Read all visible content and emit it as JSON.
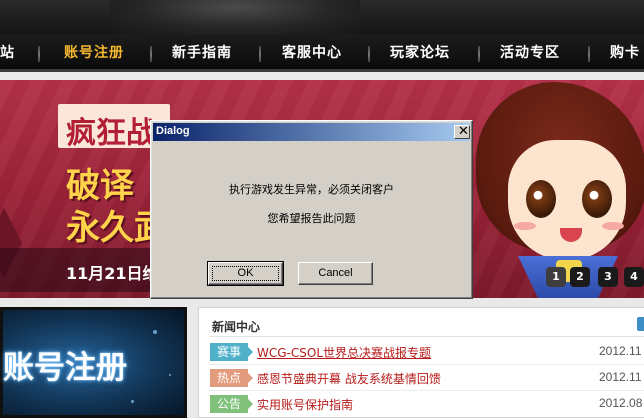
{
  "nav": {
    "items": [
      {
        "label": "站"
      },
      {
        "label": "账号注册"
      },
      {
        "label": "新手指南"
      },
      {
        "label": "客服中心"
      },
      {
        "label": "玩家论坛"
      },
      {
        "label": "活动专区"
      },
      {
        "label": "购卡"
      }
    ],
    "active_color": "#f5b830"
  },
  "banner": {
    "title_partial": "疯狂战",
    "headline_line1": "破译",
    "headline_line2": "永久武",
    "date_text": "11月21日维",
    "pager": [
      "1",
      "2",
      "3",
      "4"
    ]
  },
  "promo": {
    "label": "账号注册"
  },
  "news": {
    "title": "新闻中心",
    "rows": [
      {
        "tag": "赛事",
        "tag_color": "#4fb1c9",
        "text": "WCG-CSOL世界总决赛战报专题",
        "date": "2012.11"
      },
      {
        "tag": "热点",
        "tag_color": "#e39b7e",
        "text": "感恩节盛典开幕 战友系统基情回馈",
        "date": "2012.11"
      },
      {
        "tag": "公告",
        "tag_color": "#7fc07a",
        "text": "实用账号保护指南",
        "date": "2012.08"
      }
    ]
  },
  "dialog": {
    "title": "Dialog",
    "close_glyph": "✕",
    "message_line1": "执行游戏发生异常，必须关闭客户",
    "message_line2": "您希望报告此问题",
    "ok_label": "OK",
    "cancel_label": "Cancel"
  }
}
